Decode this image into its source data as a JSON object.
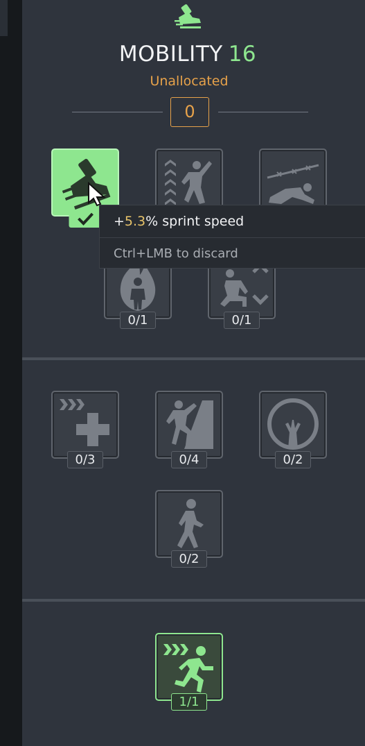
{
  "tree": {
    "title": "MOBILITY",
    "level": "16",
    "unallocated_label": "Unallocated",
    "unallocated_points": "0"
  },
  "skills": {
    "sprint_speed": {
      "icon": "sprint-shoe-icon",
      "state": "selected"
    },
    "jump_boost": {
      "icon": "jump-chevrons-icon"
    },
    "crawl": {
      "icon": "barbed-wire-crawl-icon"
    },
    "fire_resist": {
      "icon": "fire-person-icon",
      "rank": "0/1"
    },
    "crouch_move": {
      "icon": "crouch-arrows-icon",
      "rank": "0/1"
    },
    "fast_heal": {
      "icon": "fast-heal-cross-icon",
      "rank": "0/3"
    },
    "climb": {
      "icon": "climbing-icon",
      "rank": "0/4"
    },
    "holdout": {
      "icon": "tree-circle-icon",
      "rank": "0/2"
    },
    "walk": {
      "icon": "walking-person-icon",
      "rank": "0/2"
    },
    "runner": {
      "icon": "fast-runner-icon",
      "rank": "1/1",
      "state": "completed"
    }
  },
  "tooltip": {
    "prefix": "+",
    "value": "5.3",
    "suffix": "% sprint speed",
    "hint": "Ctrl+LMB to discard"
  },
  "colors": {
    "accent_green": "#8ee68f",
    "accent_orange": "#e7a24a",
    "tooltip_number": "#e7c36a",
    "panel_bg": "#2f343d"
  }
}
